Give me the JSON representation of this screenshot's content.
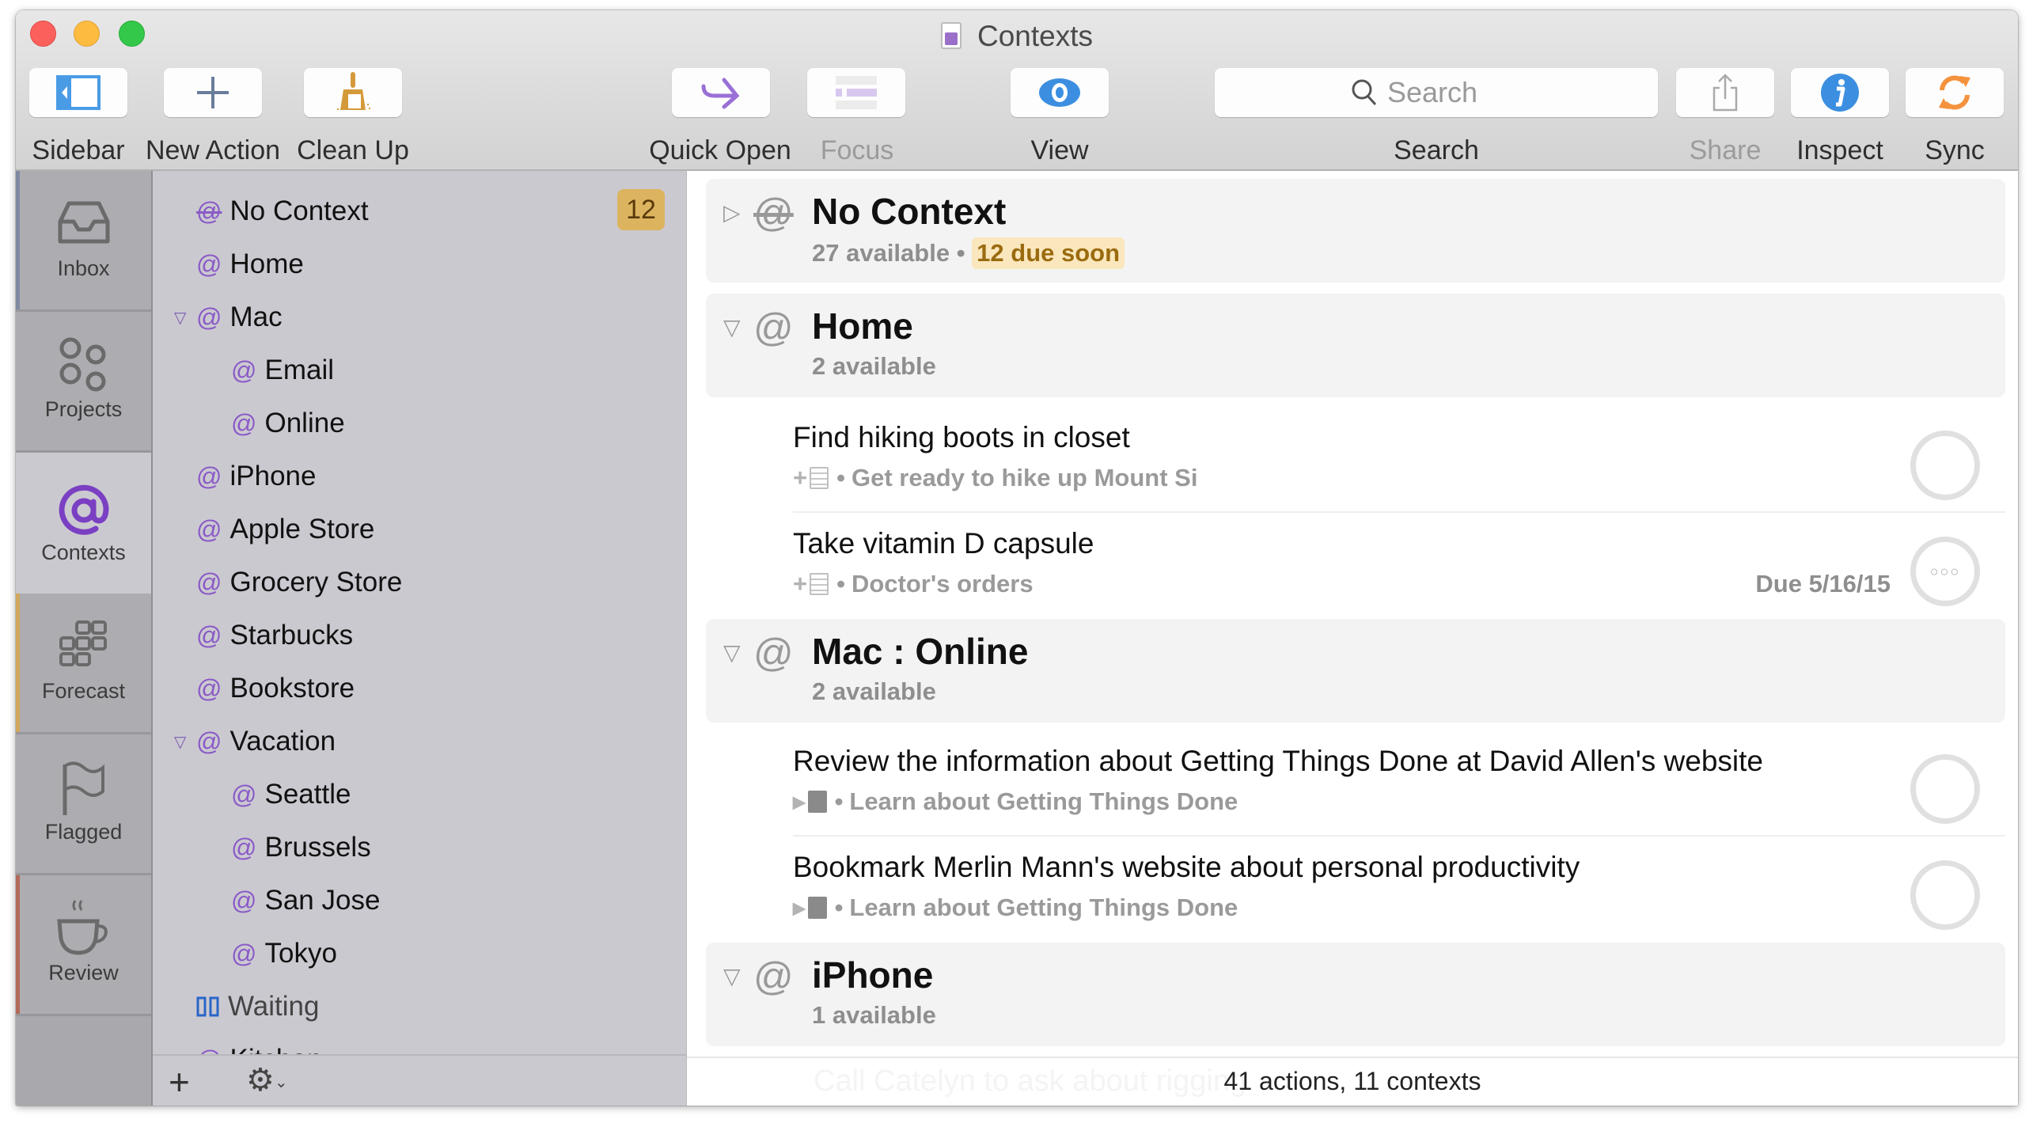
{
  "window": {
    "title": "Contexts"
  },
  "toolbar": {
    "buttons": [
      {
        "label": "Sidebar",
        "icon": "sidebar-icon",
        "enabled": true
      },
      {
        "label": "New Action",
        "icon": "plus-icon",
        "enabled": true
      },
      {
        "label": "Clean Up",
        "icon": "broom-icon",
        "enabled": true
      },
      {
        "label": "Quick Open",
        "icon": "quick-open-arrow-icon",
        "enabled": true
      },
      {
        "label": "Focus",
        "icon": "focus-list-icon",
        "enabled": false
      },
      {
        "label": "View",
        "icon": "eye-icon",
        "enabled": true
      },
      {
        "label": "Search",
        "icon": "search-icon",
        "enabled": true
      },
      {
        "label": "Share",
        "icon": "share-icon",
        "enabled": false
      },
      {
        "label": "Inspect",
        "icon": "info-icon",
        "enabled": true
      },
      {
        "label": "Sync",
        "icon": "sync-icon",
        "enabled": true
      }
    ],
    "search_placeholder": "Search",
    "colors": {
      "sidebar": "#4a9be6",
      "quick_open": "#9a6fd6",
      "view": "#3c8fe0",
      "inspect": "#3c8fe0",
      "sync": "#f5923e",
      "clean_up": "#d49a3a"
    }
  },
  "tabs": [
    {
      "label": "Inbox",
      "icon": "inbox-tray-icon",
      "active": false,
      "accent": "#7d8aa0"
    },
    {
      "label": "Projects",
      "icon": "projects-circles-icon",
      "active": false,
      "accent": ""
    },
    {
      "label": "Contexts",
      "icon": "at-sign-icon",
      "active": true,
      "accent": "#7a3fc2"
    },
    {
      "label": "Forecast",
      "icon": "forecast-grid-icon",
      "active": false,
      "accent": "#d2a85c"
    },
    {
      "label": "Flagged",
      "icon": "flag-icon",
      "active": false,
      "accent": ""
    },
    {
      "label": "Review",
      "icon": "coffee-cup-icon",
      "active": false,
      "accent": "#b36a5a"
    }
  ],
  "sidebar": {
    "items": [
      {
        "label": "No Context",
        "icon": "no-context-icon",
        "level": 0,
        "badge": "12"
      },
      {
        "label": "Home",
        "icon": "at-icon",
        "level": 0
      },
      {
        "label": "Mac",
        "icon": "at-icon",
        "level": 0,
        "expanded": true
      },
      {
        "label": "Email",
        "icon": "at-icon",
        "level": 1
      },
      {
        "label": "Online",
        "icon": "at-icon",
        "level": 1
      },
      {
        "label": "iPhone",
        "icon": "at-icon",
        "level": 0
      },
      {
        "label": "Apple Store",
        "icon": "at-icon",
        "level": 0
      },
      {
        "label": "Grocery Store",
        "icon": "at-icon",
        "level": 0
      },
      {
        "label": "Starbucks",
        "icon": "at-icon",
        "level": 0
      },
      {
        "label": "Bookstore",
        "icon": "at-icon",
        "level": 0
      },
      {
        "label": "Vacation",
        "icon": "at-icon",
        "level": 0,
        "expanded": true
      },
      {
        "label": "Seattle",
        "icon": "at-icon",
        "level": 1
      },
      {
        "label": "Brussels",
        "icon": "at-icon",
        "level": 1
      },
      {
        "label": "San Jose",
        "icon": "at-icon",
        "level": 1
      },
      {
        "label": "Tokyo",
        "icon": "at-icon",
        "level": 1
      },
      {
        "label": "Waiting",
        "icon": "waiting-pause-icon",
        "level": 0
      },
      {
        "label": "Kitchen",
        "icon": "at-icon",
        "level": 0,
        "partially_visible": true
      }
    ],
    "footer": {
      "add_label": "+",
      "gear_label": "⚙"
    }
  },
  "main": {
    "groups": [
      {
        "title": "No Context",
        "icon": "no-context-icon",
        "expanded": false,
        "available": "27 available",
        "separator": " • ",
        "due_soon": "12 due soon",
        "actions": []
      },
      {
        "title": "Home",
        "icon": "at-icon",
        "expanded": true,
        "available": "2 available",
        "actions": [
          {
            "title": "Find hiking boots in closet",
            "project": "Get ready to hike up Mount Si",
            "project_type": "single-actions",
            "due": "",
            "status": "empty"
          },
          {
            "title": "Take vitamin D capsule",
            "project": "Doctor's orders",
            "project_type": "single-actions",
            "due": "Due 5/16/15",
            "status": "repeating"
          }
        ]
      },
      {
        "title": "Mac : Online",
        "icon": "at-icon",
        "expanded": true,
        "available": "2 available",
        "actions": [
          {
            "title": "Review the information about Getting Things Done at David Allen's website",
            "project": "Learn about Getting Things Done",
            "project_type": "sequential",
            "due": "",
            "status": "empty"
          },
          {
            "title": "Bookmark Merlin Mann's website about personal productivity",
            "project": "Learn about Getting Things Done",
            "project_type": "sequential",
            "due": "",
            "status": "empty"
          }
        ]
      },
      {
        "title": "iPhone",
        "icon": "at-icon",
        "expanded": true,
        "available": "1 available",
        "actions": [
          {
            "title": "Call Catelyn to ask about rigging",
            "partially_visible": true
          }
        ]
      }
    ],
    "bullet": "•",
    "status_bar": "41 actions, 11 contexts"
  }
}
